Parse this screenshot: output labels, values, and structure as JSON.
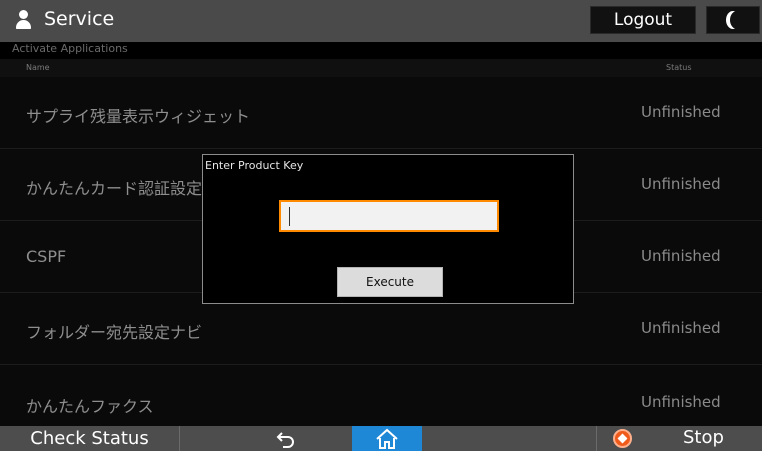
{
  "header": {
    "title": "Service",
    "subtitle": "Activate Applications",
    "logout_label": "Logout"
  },
  "list": {
    "col_name": "Name",
    "col_status": "Status",
    "rows": [
      {
        "name": "サプライ残量表示ウィジェット",
        "status": "Unfinished"
      },
      {
        "name": "かんたんカード認証設定",
        "status": "Unfinished"
      },
      {
        "name": "CSPF",
        "status": "Unfinished"
      },
      {
        "name": "フォルダー宛先設定ナビ",
        "status": "Unfinished"
      },
      {
        "name": "かんたんファクス",
        "status": "Unfinished"
      }
    ]
  },
  "dialog": {
    "title": "Enter Product Key",
    "input_value": "",
    "execute_label": "Execute"
  },
  "footer": {
    "check_status_label": "Check Status",
    "stop_label": "Stop"
  },
  "colors": {
    "accent_input_border": "#ff8a00",
    "home_button": "#1e88d6",
    "stop_icon": "#f05a1a"
  },
  "icons": {
    "user": "user-icon",
    "night_mode": "moon-icon",
    "back": "back-arrow-icon",
    "home": "home-icon",
    "stop": "stop-icon"
  }
}
